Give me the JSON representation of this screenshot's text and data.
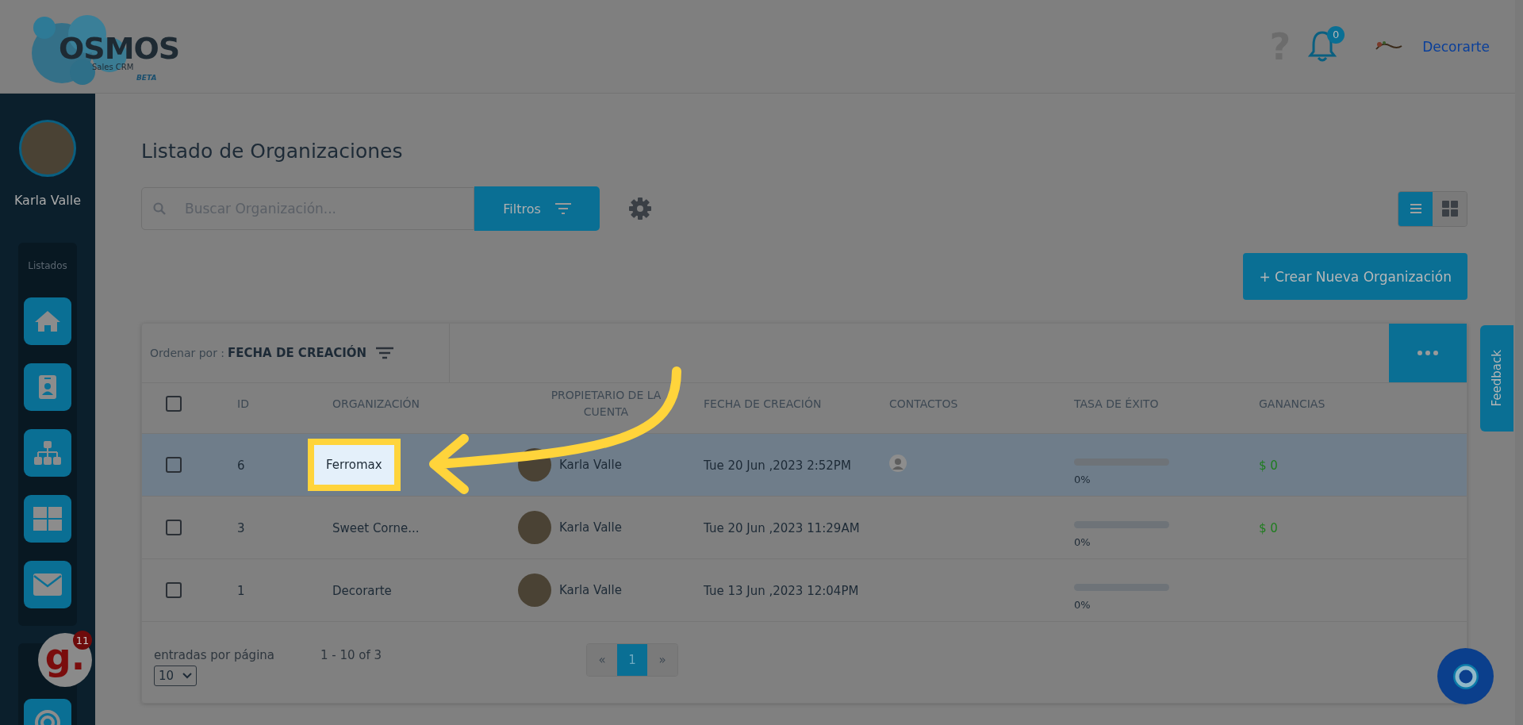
{
  "header": {
    "logo": {
      "name": "OSMOS",
      "subtitle": "Sales CRM",
      "tag": "BETA"
    },
    "help": "?",
    "notifications": {
      "count": "0"
    },
    "account": {
      "name": "Decorarte"
    }
  },
  "sidebar": {
    "user": {
      "name": "Karla Valle"
    },
    "sections": [
      {
        "title": "Listados",
        "items": [
          {
            "kind": "home"
          },
          {
            "kind": "contact"
          },
          {
            "kind": "org"
          },
          {
            "kind": "grid"
          },
          {
            "kind": "mail"
          }
        ]
      },
      {
        "items": [
          {
            "kind": "target"
          }
        ]
      }
    ]
  },
  "widget": {
    "letter": "g.",
    "badge": "11"
  },
  "page": {
    "title": "Listado de Organizaciones"
  },
  "toolbar": {
    "search": {
      "placeholder": "Buscar Organización..."
    },
    "filter_button": "Filtros",
    "views": [
      {
        "kind": "list",
        "selected": true
      },
      {
        "kind": "grid",
        "selected": false
      }
    ],
    "create_button": "+ Crear Nueva Organización"
  },
  "table": {
    "select_all": {
      "checked": false
    },
    "sort_label": "Ordenar por :",
    "sort_value": "FECHA DE CREACIÓN",
    "columns": [
      "ID",
      "ORGANIZACIÓN",
      "PROPIETARIO DE LA CUENTA",
      "FECHA DE CREACIÓN",
      "CONTACTOS",
      "TASA DE ÉXITO",
      "GANANCIAS"
    ],
    "rows": [
      {
        "checked": false,
        "highlighted": true,
        "callout": true,
        "id": "6",
        "organization": "Ferromax",
        "owner": "Karla Valle",
        "created": "Tue 20 Jun ,2023 2:52PM",
        "has_contact": true,
        "level": 0,
        "rate": "0%",
        "earnings": "$ 0"
      },
      {
        "checked": false,
        "highlighted": false,
        "callout": false,
        "id": "3",
        "organization": "Sweet Corne...",
        "owner": "Karla Valle",
        "created": "Tue 20 Jun ,2023 11:29AM",
        "has_contact": false,
        "level": 0,
        "rate": "0%",
        "earnings": "$ 0"
      },
      {
        "checked": false,
        "highlighted": false,
        "callout": false,
        "id": "1",
        "organization": "Decorarte",
        "owner": "Karla Valle",
        "created": "Tue 13 Jun ,2023 12:04PM",
        "has_contact": false,
        "level": 0,
        "rate": "0%"
      }
    ],
    "footer": {
      "per_page_label": "entradas por página",
      "per_page": "10",
      "range": "1 - 10 of 3",
      "prev": "«",
      "pages": [
        {
          "label": "1",
          "selected": true
        }
      ],
      "next": "»"
    }
  },
  "feedback": "Feedback"
}
